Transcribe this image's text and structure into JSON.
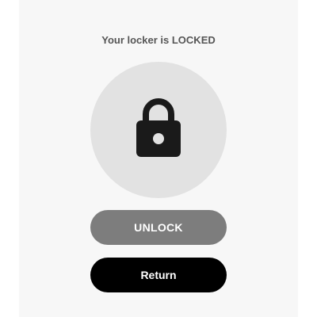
{
  "status": {
    "title": "Your locker is LOCKED"
  },
  "lock": {
    "icon": "lock-icon",
    "circle_color": "#e2e2e2"
  },
  "buttons": {
    "unlock_label": "UNLOCK",
    "return_label": "Return",
    "unlock_color": "#7d7d7d",
    "return_color": "#000000"
  }
}
